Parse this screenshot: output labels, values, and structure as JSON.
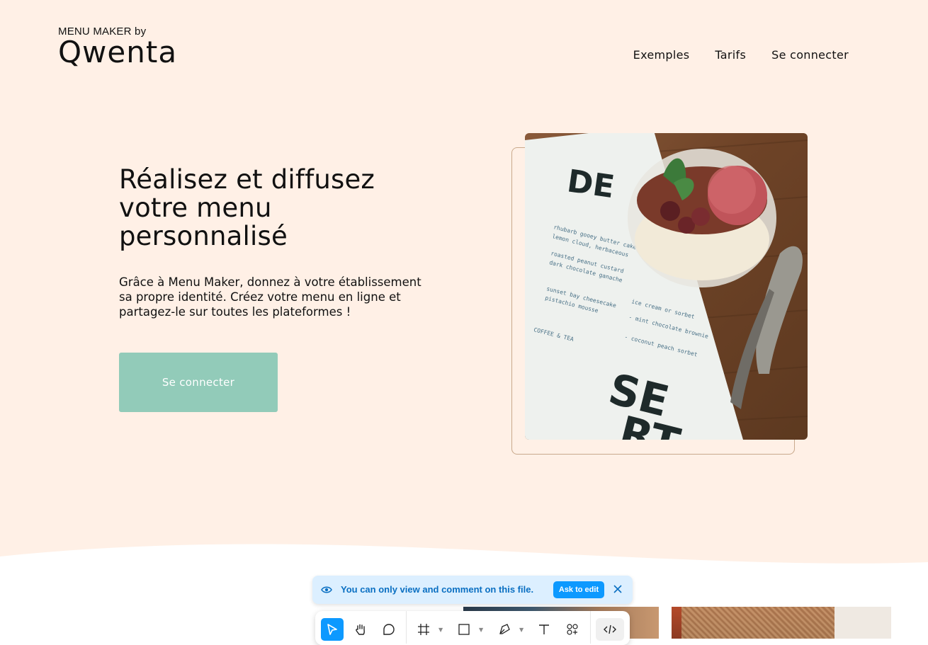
{
  "header": {
    "logo_top": "MENU MAKER by",
    "logo_word": "Qwenta",
    "nav": [
      "Exemples",
      "Tarifs",
      "Se connecter"
    ]
  },
  "hero": {
    "title_lines": [
      "Réalisez et diffusez",
      "votre menu",
      "personnalisé"
    ],
    "subtitle_lines": [
      "Grâce à Menu Maker, donnez à votre établissement",
      "sa propre identité. Créez votre menu en ligne et",
      "partagez-le sur toutes les plateformes !"
    ],
    "cta_label": "Se connecter"
  },
  "colors": {
    "hero_bg": "#fff0e6",
    "cta": "#92cbb9",
    "accent": "#0d99ff"
  },
  "banner": {
    "text": "You can only view and comment on this file.",
    "ask_label": "Ask to edit"
  },
  "toolbar": {
    "tools": [
      "move-icon",
      "hand-icon",
      "comment-icon",
      "frame-icon",
      "rectangle-icon",
      "pen-icon",
      "text-icon",
      "components-icon",
      "dev-mode-icon"
    ],
    "active_tool": "move-icon"
  }
}
